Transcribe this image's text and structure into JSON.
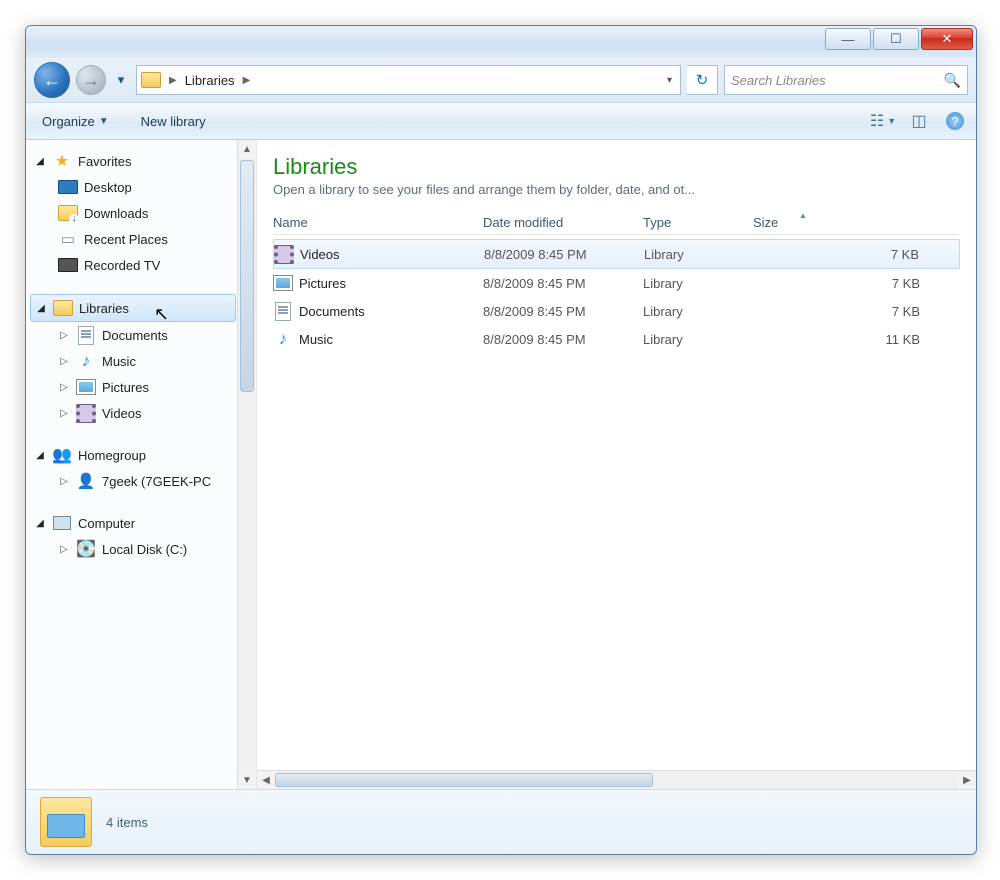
{
  "breadcrumb": {
    "root_label": "Libraries"
  },
  "search": {
    "placeholder": "Search Libraries"
  },
  "toolbar": {
    "organize": "Organize",
    "new_library": "New library"
  },
  "nav": {
    "favorites": {
      "label": "Favorites",
      "items": [
        {
          "label": "Desktop"
        },
        {
          "label": "Downloads"
        },
        {
          "label": "Recent Places"
        },
        {
          "label": "Recorded TV"
        }
      ]
    },
    "libraries": {
      "label": "Libraries",
      "items": [
        {
          "label": "Documents"
        },
        {
          "label": "Music"
        },
        {
          "label": "Pictures"
        },
        {
          "label": "Videos"
        }
      ]
    },
    "homegroup": {
      "label": "Homegroup",
      "items": [
        {
          "label": "7geek (7GEEK-PC"
        }
      ]
    },
    "computer": {
      "label": "Computer",
      "items": [
        {
          "label": "Local Disk (C:)"
        }
      ]
    }
  },
  "content": {
    "title": "Libraries",
    "subtitle": "Open a library to see your files and arrange them by folder, date, and ot...",
    "columns": {
      "name": "Name",
      "date": "Date modified",
      "type": "Type",
      "size": "Size"
    },
    "items": [
      {
        "name": "Videos",
        "date": "8/8/2009 8:45 PM",
        "type": "Library",
        "size": "7 KB"
      },
      {
        "name": "Pictures",
        "date": "8/8/2009 8:45 PM",
        "type": "Library",
        "size": "7 KB"
      },
      {
        "name": "Documents",
        "date": "8/8/2009 8:45 PM",
        "type": "Library",
        "size": "7 KB"
      },
      {
        "name": "Music",
        "date": "8/8/2009 8:45 PM",
        "type": "Library",
        "size": "11 KB"
      }
    ]
  },
  "status": {
    "count": "4 items"
  }
}
